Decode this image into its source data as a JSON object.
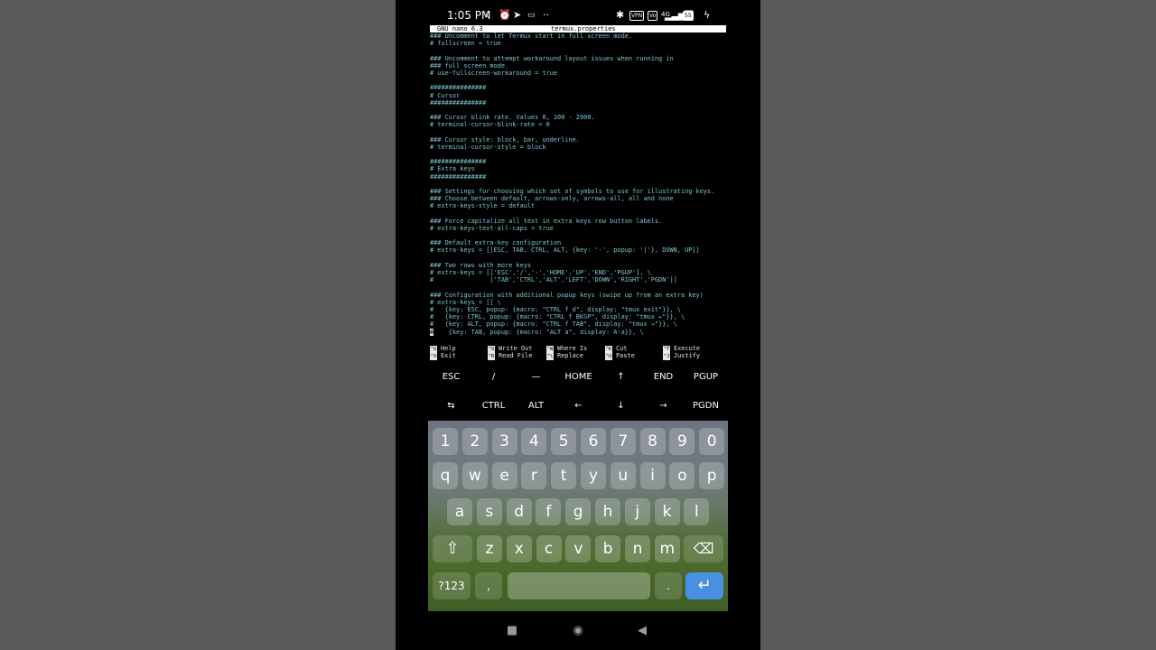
{
  "status_bar": {
    "time": "1:05 PM",
    "left_icons": [
      "moon-icon",
      "alarm-icon",
      "telegram-icon",
      "message-icon",
      "more-icon"
    ],
    "right_icons": [
      "bluetooth-icon",
      "vpn-icon",
      "volte-icon",
      "signal-icon",
      "battery-icon",
      "charging-icon"
    ],
    "vpn_label": "VPN",
    "battery_level": "55",
    "network_label": "4G"
  },
  "nano": {
    "title": "GNU nano 6.3",
    "filename": "termux.properties",
    "lines": [
      "### Uncomment to let Termux start in full screen mode.",
      "# fullscreen = true",
      "",
      "### Uncomment to attempt workaround layout issues when running in",
      "### full screen mode.",
      "# use-fullscreen-workaround = true",
      "",
      "###############",
      "# Cursor",
      "###############",
      "",
      "### Cursor blink rate. Values 0, 100 - 2000.",
      "# terminal-cursor-blink-rate = 0",
      "",
      "### Cursor style: block, bar, underline.",
      "# terminal-cursor-style = block",
      "",
      "###############",
      "# Extra keys",
      "###############",
      "",
      "### Settings for choosing which set of symbols to use for illustrating keys.",
      "### Choose between default, arrows-only, arrows-all, all and none",
      "# extra-keys-style = default",
      "",
      "### Force capitalize all text in extra keys row button labels.",
      "# extra-keys-text-all-caps = true",
      "",
      "### Default extra-key configuration",
      "# extra-keys = [[ESC, TAB, CTRL, ALT, {key: '-', popup: '|'}, DOWN, UP]]",
      "",
      "### Two rows with more keys",
      "# extra-keys = [['ESC','/','-','HOME','UP','END','PGUP'], \\",
      "#               ['TAB','CTRL','ALT','LEFT','DOWN','RIGHT','PGDN']]",
      "",
      "### Configuration with additional popup keys (swipe up from an extra key)",
      "# extra-keys = [[ \\",
      "#   {key: ESC, popup: {macro: \"CTRL f d\", display: \"tmux exit\"}}, \\",
      "#   {key: CTRL, popup: {macro: \"CTRL f BKSP\", display: \"tmux ←\"}}, \\",
      "#   {key: ALT, popup: {macro: \"CTRL f TAB\", display: \"tmux →\"}}, \\",
      "    {key: TAB, popup: {macro: \"ALT a\", display: A-a}}, \\"
    ],
    "last_line_marker": "#",
    "shortcuts": [
      {
        "key1": "^G",
        "label1": "Help",
        "key2": "^X",
        "label2": "Exit"
      },
      {
        "key1": "^O",
        "label1": "Write Out",
        "key2": "^R",
        "label2": "Read File"
      },
      {
        "key1": "^W",
        "label1": "Where Is",
        "key2": "^\\",
        "label2": "Replace"
      },
      {
        "key1": "^K",
        "label1": "Cut",
        "key2": "^U",
        "label2": "Paste"
      },
      {
        "key1": "^T",
        "label1": "Execute",
        "key2": "^J",
        "label2": "Justify"
      }
    ]
  },
  "extra_keys": {
    "row1": [
      "ESC",
      "/",
      "—",
      "HOME",
      "↑",
      "END",
      "PGUP"
    ],
    "row2": [
      "⇆",
      "CTRL",
      "ALT",
      "←",
      "↓",
      "→",
      "PGDN"
    ]
  },
  "keyboard": {
    "numbers": [
      "1",
      "2",
      "3",
      "4",
      "5",
      "6",
      "7",
      "8",
      "9",
      "0"
    ],
    "row1": [
      "q",
      "w",
      "e",
      "r",
      "t",
      "y",
      "u",
      "i",
      "o",
      "p"
    ],
    "row2": [
      "a",
      "s",
      "d",
      "f",
      "g",
      "h",
      "j",
      "k",
      "l"
    ],
    "row3": [
      "z",
      "x",
      "c",
      "v",
      "b",
      "n",
      "m"
    ],
    "shift_icon": "⇧",
    "backspace_icon": "⌫",
    "symbols_label": "?123",
    "comma": ",",
    "period": ".",
    "enter_icon": "↵"
  },
  "nav_bar": {
    "recents_icon": "■",
    "home_icon": "◉",
    "back_icon": "◀"
  }
}
